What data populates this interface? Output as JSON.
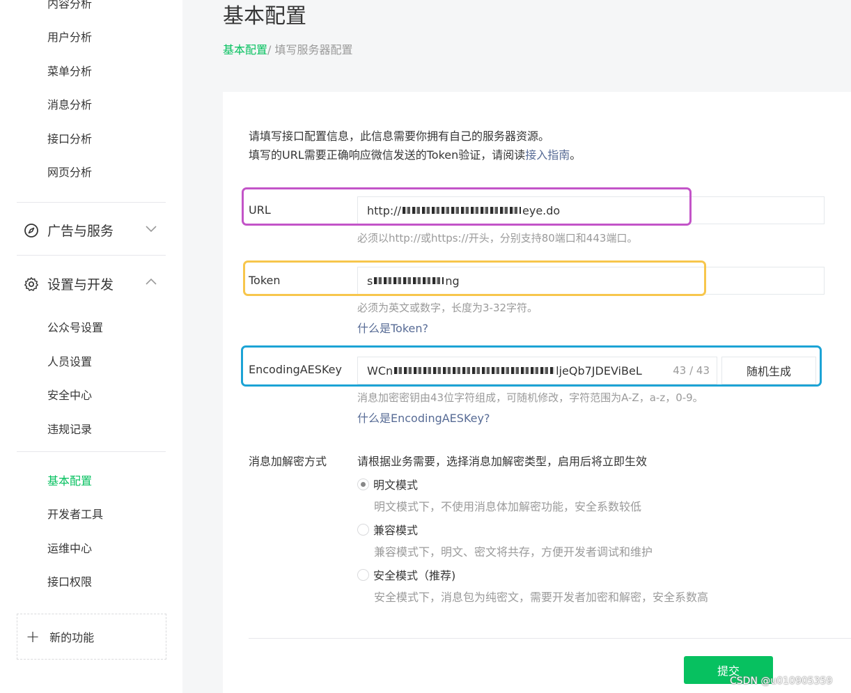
{
  "sidebar": {
    "top_items": [
      {
        "label": "内容分析"
      },
      {
        "label": "用户分析"
      },
      {
        "label": "菜单分析"
      },
      {
        "label": "消息分析"
      },
      {
        "label": "接口分析"
      },
      {
        "label": "网页分析"
      }
    ],
    "group_ads": {
      "label": "广告与服务",
      "icon": "compass-icon",
      "state": "collapsed"
    },
    "group_settings": {
      "label": "设置与开发",
      "icon": "gear-icon",
      "state": "expanded"
    },
    "settings_items": [
      {
        "label": "公众号设置"
      },
      {
        "label": "人员设置"
      },
      {
        "label": "安全中心"
      },
      {
        "label": "违规记录"
      }
    ],
    "dev_items": [
      {
        "label": "基本配置",
        "active": true
      },
      {
        "label": "开发者工具"
      },
      {
        "label": "运维中心"
      },
      {
        "label": "接口权限"
      }
    ],
    "new_function": {
      "label": "新的功能"
    }
  },
  "header": {
    "title": "基本配置",
    "breadcrumb_link": "基本配置",
    "breadcrumb_sep_current": "/ 填写服务器配置"
  },
  "intro": {
    "line1": "请填写接口配置信息，此信息需要你拥有自己的服务器资源。",
    "line2_prefix": "填写的URL需要正确响应微信发送的Token验证，请阅读",
    "guide_link": "接入指南",
    "line2_suffix": "。"
  },
  "url_field": {
    "label": "URL",
    "value_start": "http://",
    "value_end": "eye.do",
    "hint": "必须以http://或https://开头，分别支持80端口和443端口。"
  },
  "token_field": {
    "label": "Token",
    "value_start": "s",
    "value_end": "ng",
    "hint": "必须为英文或数字，长度为3-32字符。",
    "help_link": "什么是Token?"
  },
  "aes_field": {
    "label": "EncodingAESKey",
    "value_start": "WCn",
    "value_end": "ljeQb7JDEViBeL",
    "count": "43 / 43",
    "generate_button": "随机生成",
    "hint": "消息加密密钥由43位字符组成，可随机修改，字符范围为A-Z，a-z，0-9。",
    "help_link": "什么是EncodingAESKey?"
  },
  "encryption": {
    "label": "消息加解密方式",
    "description": "请根据业务需要，选择消息加解密类型，启用后将立即生效",
    "options": [
      {
        "label": "明文模式",
        "desc": "明文模式下，不使用消息体加解密功能，安全系数较低",
        "checked": true
      },
      {
        "label": "兼容模式",
        "desc": "兼容模式下，明文、密文将共存，方便开发者调试和维护",
        "checked": false
      },
      {
        "label": "安全模式（推荐)",
        "desc": "安全模式下，消息包为纯密文，需要开发者加密和解密，安全系数高",
        "checked": false
      }
    ]
  },
  "submit": {
    "label": "提交"
  },
  "watermark": "CSDN @u010905359",
  "colors": {
    "accent": "#07c160",
    "link": "#576b95",
    "highlight_url": "#c354c8",
    "highlight_token": "#f7c64c",
    "highlight_aes": "#1ca3d5"
  }
}
